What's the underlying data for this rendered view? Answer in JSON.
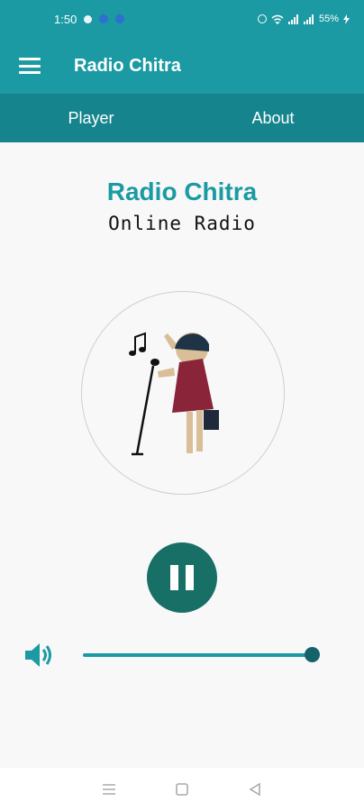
{
  "status_bar": {
    "time": "1:50",
    "battery": "55%"
  },
  "app_bar": {
    "title": "Radio Chitra",
    "menu_icon": "hamburger-menu-icon"
  },
  "tabs": [
    {
      "label": "Player",
      "active": true
    },
    {
      "label": "About",
      "active": false
    }
  ],
  "player": {
    "station_name": "Radio Chitra",
    "subtitle": "Online Radio",
    "artwork": "singer-with-microphone-illustration",
    "state": "playing",
    "control_icon": "pause-icon",
    "volume_level": 1.0
  },
  "nav": {
    "recents_icon": "recents-icon",
    "home_icon": "home-icon",
    "back_icon": "back-icon"
  },
  "colors": {
    "primary": "#1b9aa3",
    "tab_bar": "#15848c",
    "control": "#176f66"
  }
}
